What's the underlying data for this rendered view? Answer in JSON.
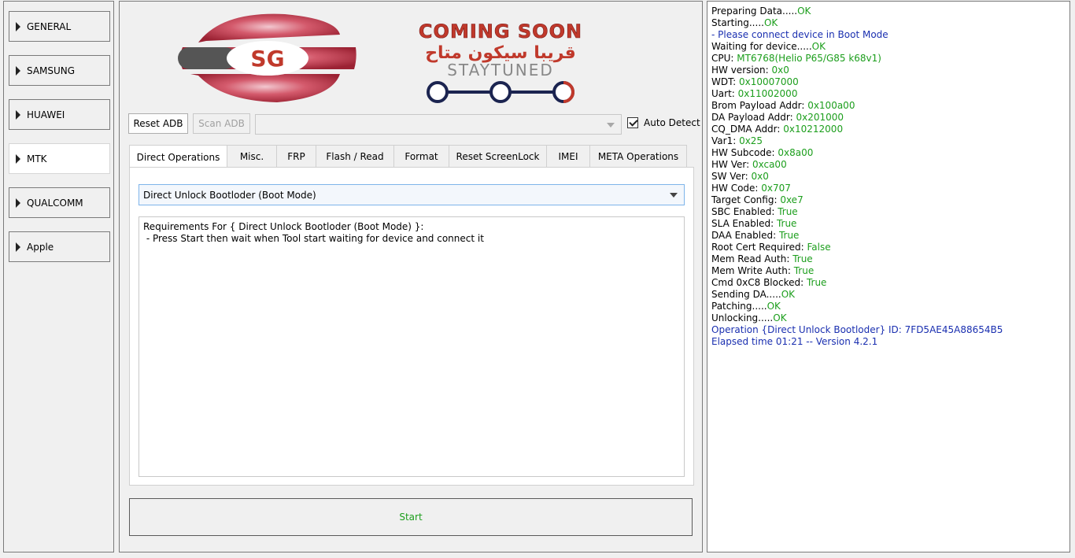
{
  "colors": {
    "ok_green": "#1c9e1c",
    "info_blue": "#1a2fb0",
    "banner_red": "#c0392b",
    "banner_navy": "#1b2450"
  },
  "sidebar": {
    "items": [
      {
        "label": "GENERAL",
        "active": false
      },
      {
        "label": "SAMSUNG",
        "active": false
      },
      {
        "label": "HUAWEI",
        "active": false
      },
      {
        "label": "MTK",
        "active": true
      },
      {
        "label": "QUALCOMM",
        "active": false
      },
      {
        "label": "Apple",
        "active": false
      }
    ]
  },
  "banner": {
    "logo_text": "SG",
    "coming_soon": "COMING SOON",
    "arabic": "قريبا سيكون متاح",
    "stay_tuned": "STAYTUNED"
  },
  "toolbar": {
    "reset_adb": "Reset ADB",
    "scan_adb": "Scan ADB",
    "device_combo_value": "",
    "auto_detect": "Auto Detect",
    "auto_detect_checked": true
  },
  "tabs": [
    {
      "label": "Direct Operations",
      "active": true
    },
    {
      "label": "Misc.",
      "active": false
    },
    {
      "label": "FRP",
      "active": false
    },
    {
      "label": "Flash / Read",
      "active": false
    },
    {
      "label": "Format",
      "active": false
    },
    {
      "label": "Reset ScreenLock",
      "active": false
    },
    {
      "label": "IMEI",
      "active": false
    },
    {
      "label": "META Operations",
      "active": false
    }
  ],
  "operation": {
    "selected": "Direct Unlock Bootloder (Boot Mode)",
    "requirements": "Requirements For { Direct Unlock Bootloder (Boot Mode) }:\n - Press Start then wait when Tool start waiting for device and connect it"
  },
  "start_label": "Start",
  "log": [
    [
      {
        "t": "Preparing Data.....",
        "c": "black"
      },
      {
        "t": "OK",
        "c": "green"
      }
    ],
    [
      {
        "t": "Starting.....",
        "c": "black"
      },
      {
        "t": "OK",
        "c": "green"
      }
    ],
    [
      {
        "t": " - Please connect device in Boot Mode",
        "c": "blue"
      }
    ],
    [
      {
        "t": "Waiting for device.....",
        "c": "black"
      },
      {
        "t": "OK",
        "c": "green"
      }
    ],
    [
      {
        "t": "CPU: ",
        "c": "black"
      },
      {
        "t": "MT6768(Helio P65/G85 k68v1)",
        "c": "green"
      }
    ],
    [
      {
        "t": "HW version: ",
        "c": "black"
      },
      {
        "t": "0x0",
        "c": "green"
      }
    ],
    [
      {
        "t": "WDT: ",
        "c": "black"
      },
      {
        "t": "0x10007000",
        "c": "green"
      }
    ],
    [
      {
        "t": "Uart: ",
        "c": "black"
      },
      {
        "t": "0x11002000",
        "c": "green"
      }
    ],
    [
      {
        "t": "Brom Payload Addr: ",
        "c": "black"
      },
      {
        "t": "0x100a00",
        "c": "green"
      }
    ],
    [
      {
        "t": "DA Payload Addr: ",
        "c": "black"
      },
      {
        "t": "0x201000",
        "c": "green"
      }
    ],
    [
      {
        "t": "CQ_DMA Addr: ",
        "c": "black"
      },
      {
        "t": "0x10212000",
        "c": "green"
      }
    ],
    [
      {
        "t": "Var1: ",
        "c": "black"
      },
      {
        "t": "0x25",
        "c": "green"
      }
    ],
    [
      {
        "t": "HW Subcode: ",
        "c": "black"
      },
      {
        "t": "0x8a00",
        "c": "green"
      }
    ],
    [
      {
        "t": "HW Ver: ",
        "c": "black"
      },
      {
        "t": "0xca00",
        "c": "green"
      }
    ],
    [
      {
        "t": "SW Ver: ",
        "c": "black"
      },
      {
        "t": "0x0",
        "c": "green"
      }
    ],
    [
      {
        "t": "HW Code: ",
        "c": "black"
      },
      {
        "t": "0x707",
        "c": "green"
      }
    ],
    [
      {
        "t": "Target Config: ",
        "c": "black"
      },
      {
        "t": "0xe7",
        "c": "green"
      }
    ],
    [
      {
        "t": "SBC Enabled: ",
        "c": "black"
      },
      {
        "t": "True",
        "c": "green"
      }
    ],
    [
      {
        "t": "SLA Enabled: ",
        "c": "black"
      },
      {
        "t": "True",
        "c": "green"
      }
    ],
    [
      {
        "t": "DAA Enabled: ",
        "c": "black"
      },
      {
        "t": "True",
        "c": "green"
      }
    ],
    [
      {
        "t": "Root Cert Required: ",
        "c": "black"
      },
      {
        "t": "False",
        "c": "green"
      }
    ],
    [
      {
        "t": "Mem Read Auth: ",
        "c": "black"
      },
      {
        "t": "True",
        "c": "green"
      }
    ],
    [
      {
        "t": "Mem Write Auth: ",
        "c": "black"
      },
      {
        "t": "True",
        "c": "green"
      }
    ],
    [
      {
        "t": "Cmd 0xC8 Blocked: ",
        "c": "black"
      },
      {
        "t": "True",
        "c": "green"
      }
    ],
    [
      {
        "t": "Sending DA.....",
        "c": "black"
      },
      {
        "t": "OK",
        "c": "green"
      }
    ],
    [
      {
        "t": "Patching.....",
        "c": "black"
      },
      {
        "t": "OK",
        "c": "green"
      }
    ],
    [
      {
        "t": "Unlocking.....",
        "c": "black"
      },
      {
        "t": "OK",
        "c": "green"
      }
    ],
    [
      {
        "t": "Operation {Direct Unlock Bootloder} ID: 7FD5AE45A88654B5",
        "c": "blue"
      }
    ],
    [
      {
        "t": "Elapsed time 01:21 -- Version 4.2.1",
        "c": "blue"
      }
    ]
  ]
}
